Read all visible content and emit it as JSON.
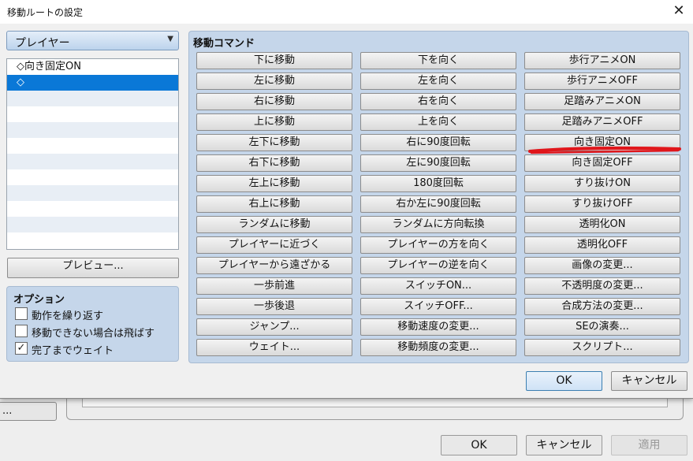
{
  "dialog": {
    "title": "移動ルートの設定",
    "close_label": "✕"
  },
  "target": {
    "selected": "プレイヤー",
    "arrow": "▼"
  },
  "route_list": [
    "◇向き固定ON",
    "◇"
  ],
  "preview_label": "プレビュー...",
  "options": {
    "title": "オプション",
    "items": [
      {
        "label": "動作を繰り返す",
        "checked": false
      },
      {
        "label": "移動できない場合は飛ばす",
        "checked": false
      },
      {
        "label": "完了までウェイト",
        "checked": true
      }
    ]
  },
  "commands": {
    "title": "移動コマンド",
    "columns": [
      [
        "下に移動",
        "左に移動",
        "右に移動",
        "上に移動",
        "左下に移動",
        "右下に移動",
        "左上に移動",
        "右上に移動",
        "ランダムに移動",
        "プレイヤーに近づく",
        "プレイヤーから遠ざかる",
        "一歩前進",
        "一歩後退",
        "ジャンプ...",
        "ウェイト..."
      ],
      [
        "下を向く",
        "左を向く",
        "右を向く",
        "上を向く",
        "右に90度回転",
        "左に90度回転",
        "180度回転",
        "右か左に90度回転",
        "ランダムに方向転換",
        "プレイヤーの方を向く",
        "プレイヤーの逆を向く",
        "スイッチON...",
        "スイッチOFF...",
        "移動速度の変更...",
        "移動頻度の変更..."
      ],
      [
        "歩行アニメON",
        "歩行アニメOFF",
        "足踏みアニメON",
        "足踏みアニメOFF",
        "向き固定ON",
        "向き固定OFF",
        "すり抜けON",
        "すり抜けOFF",
        "透明化ON",
        "透明化OFF",
        "画像の変更...",
        "不透明度の変更...",
        "合成方法の変更...",
        "SEの演奏...",
        "スクリプト..."
      ]
    ]
  },
  "footer": {
    "ok": "OK",
    "cancel": "キャンセル"
  },
  "background_window": {
    "left_button": "...",
    "ok": "OK",
    "cancel": "キャンセル",
    "apply": "適用"
  },
  "colors": {
    "panel_bg": "#c5d6ea",
    "selection": "#0a78d7",
    "annotation_red": "#e0161b"
  }
}
